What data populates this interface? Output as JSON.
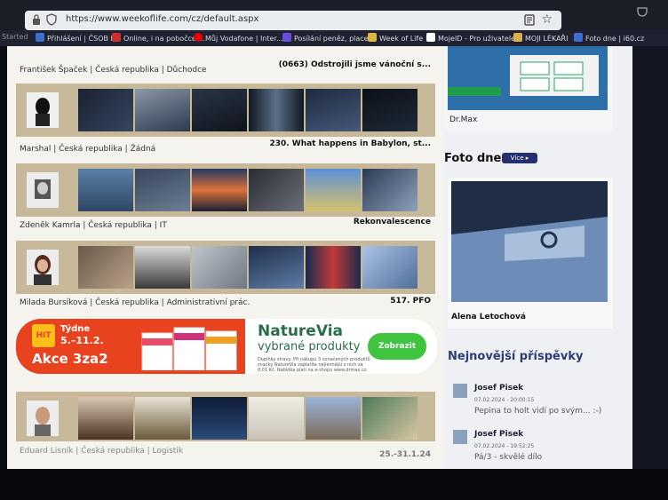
{
  "browser": {
    "url": "https://www.weekoflife.com/cz/default.aspx",
    "started_label": "Started",
    "bookmarks": [
      {
        "label": "Přihlášení | ČSOB ID",
        "color": "#3b6fd0"
      },
      {
        "label": "Online, i na pobočce ...",
        "color": "#cf2e2e"
      },
      {
        "label": "Můj Vodafone | Inter...",
        "color": "#e60000"
      },
      {
        "label": "Posílání peněz, place...",
        "color": "#6b4ce0"
      },
      {
        "label": "Week of Life",
        "color": "#e0b53b"
      },
      {
        "label": "MojeID - Pro uživatele",
        "color": "#444444"
      },
      {
        "label": "MOJI LÉKAŘI",
        "color": "#d9b04a"
      },
      {
        "label": "Foto dne | i60.cz",
        "color": "#3b6fd0"
      }
    ]
  },
  "posts": [
    {
      "user_line": "František Špaček | Česká republika | Důchodce",
      "title": "(0663) Odstrojili jsme vánoční s..."
    },
    {
      "user_line": "Marshal | Česká republika | Žádná",
      "title": "230. What happens in Babylon, st..."
    },
    {
      "user_line": "Zdeněk Kamrla | Česká republika | IT",
      "title": "Rekonvalescence"
    },
    {
      "user_line": "Milada Bursíková | Česká republika | Administrativní prác.",
      "title": "517. PFO"
    },
    {
      "user_line": "Eduard Lisník | Česká republika | Logistik",
      "title": "25.-31.1.24"
    }
  ],
  "ad": {
    "hit": "HIT",
    "week_label": "Týdne",
    "dates": "5.–11.2.",
    "promo": "Akce 3za2",
    "brand": "NatureVia",
    "subtitle": "vybrané produkty",
    "fine_print": "Doplňky stravy. Při nákupu 3 označených produktů značky NatureVia zaplatíte nejlevnější z nich za 0,01 Kč. Nabídka platí na e-shopu www.drmax.cz.",
    "button": "Zobrazit"
  },
  "sidebar": {
    "drmax_label": "Dr.Max",
    "photo_day_title": "Foto dne",
    "more_button": "Více",
    "photo_author": "Alena Letochová",
    "newest_title": "Nejnovější příspěvky",
    "comments": [
      {
        "name": "Josef Pisek",
        "date": "07.02.2024 - 20:00:15",
        "text": "Pepina to holt vidí po svým... :-)"
      },
      {
        "name": "Josef Pisek",
        "date": "07.02.2024 - 19:52:25",
        "text": "Pá/3 - skvělé dílo"
      }
    ]
  },
  "colors": {
    "accent": "#24306e",
    "strip": "#c8b89a",
    "ad_red": "#e8421e",
    "ad_green": "#3ec43f"
  }
}
